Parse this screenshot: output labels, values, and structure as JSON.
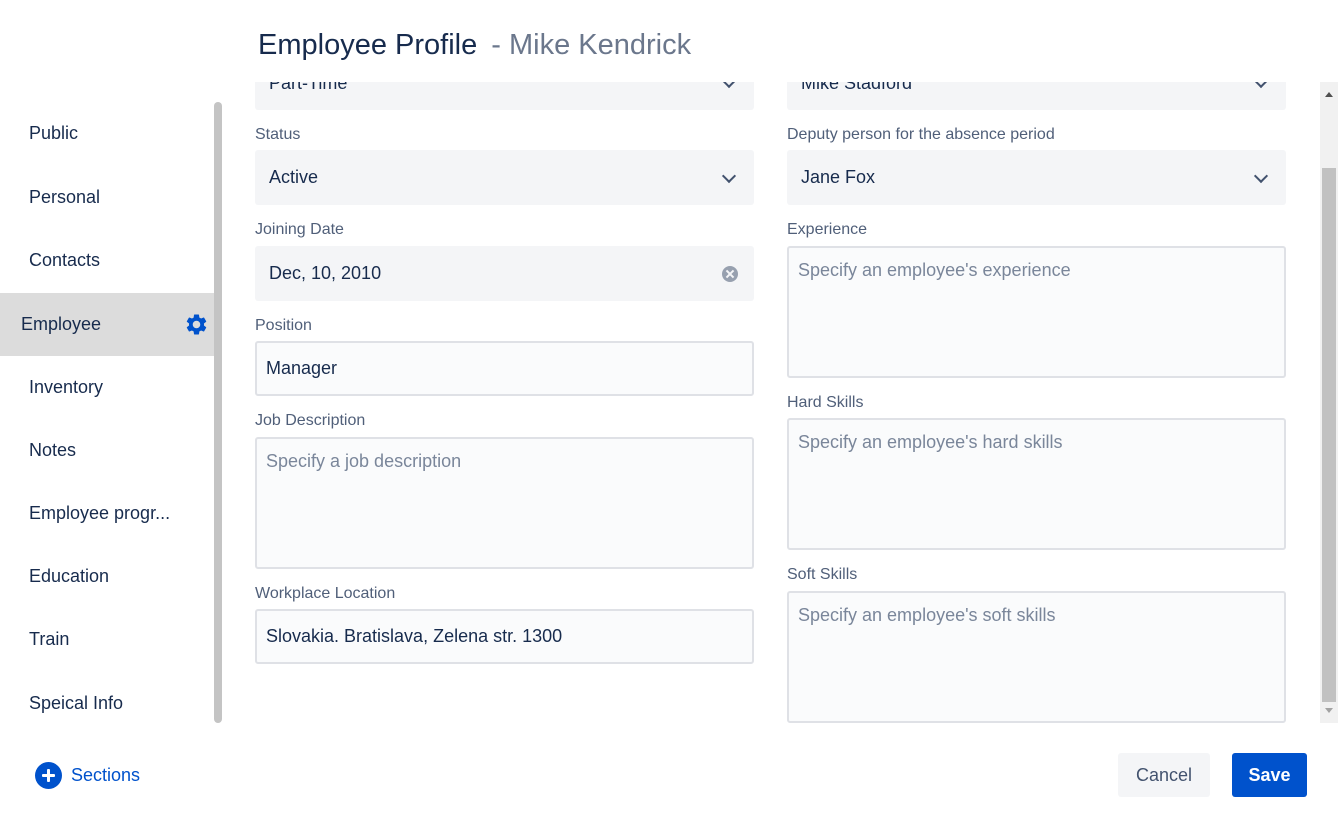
{
  "header": {
    "title": "Employee Profile",
    "subtitle": "- Mike Kendrick"
  },
  "sidebar": {
    "items": [
      {
        "label": "Public"
      },
      {
        "label": "Personal"
      },
      {
        "label": "Contacts"
      },
      {
        "label": "Employee",
        "active": true,
        "icon": "gear-icon"
      },
      {
        "label": "Inventory"
      },
      {
        "label": "Notes"
      },
      {
        "label": "Employee progr..."
      },
      {
        "label": "Education"
      },
      {
        "label": "Train"
      },
      {
        "label": "Speical Info"
      }
    ]
  },
  "form": {
    "partial_top_left": "Part-Time",
    "partial_top_right": "Mike Stadford",
    "status": {
      "label": "Status",
      "value": "Active"
    },
    "joining_date": {
      "label": "Joining Date",
      "value": "Dec, 10, 2010"
    },
    "position": {
      "label": "Position",
      "value": "Manager"
    },
    "job_description": {
      "label": "Job Description",
      "placeholder": "Specify a job description"
    },
    "workplace_location": {
      "label": "Workplace Location",
      "value": "Slovakia. Bratislava, Zelena str. 1300"
    },
    "deputy": {
      "label": "Deputy person for the absence period",
      "value": "Jane Fox"
    },
    "experience": {
      "label": "Experience",
      "placeholder": "Specify an employee's experience"
    },
    "hard_skills": {
      "label": "Hard Skills",
      "placeholder": "Specify an employee's hard skills"
    },
    "soft_skills": {
      "label": "Soft Skills",
      "placeholder": "Specify an employee's soft skills"
    }
  },
  "footer": {
    "sections_label": "Sections",
    "cancel_label": "Cancel",
    "save_label": "Save"
  },
  "colors": {
    "accent": "#0052cc",
    "text": "#172b4d",
    "muted": "#6b778c",
    "active_nav_bg": "#dcdcdc"
  }
}
